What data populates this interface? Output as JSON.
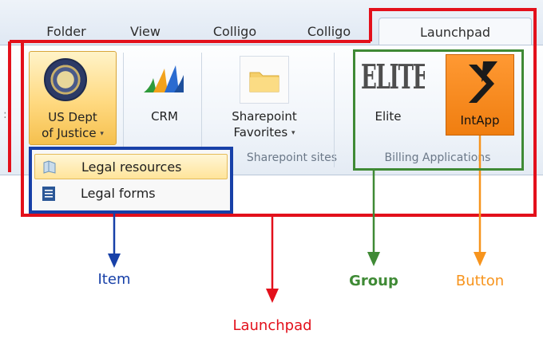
{
  "ribbon": {
    "tabs": [
      "Folder",
      "View",
      "Colligo",
      "Colligo"
    ],
    "active_tab": "Launchpad",
    "buttons": {
      "doj": {
        "line1": "US Dept",
        "line2": "of Justice",
        "caret": "▾",
        "icon": "seal-icon"
      },
      "crm": {
        "label": "CRM",
        "icon": "crm-icon"
      },
      "sharepoint": {
        "line1": "Sharepoint",
        "line2": "Favorites",
        "caret": "▾",
        "icon": "folder-icon"
      },
      "elite": {
        "label": "Elite",
        "logo_text": "ELITE"
      },
      "intapp": {
        "label": "IntApp",
        "icon": "intapp-icon"
      }
    },
    "groups": {
      "sharepoint": "Sharepoint sites",
      "billing": "Billing Applications"
    }
  },
  "dropdown": {
    "items": [
      {
        "label": "Legal resources",
        "icon": "book-icon",
        "highlighted": true
      },
      {
        "label": "Legal forms",
        "icon": "document-icon",
        "highlighted": false
      }
    ]
  },
  "annotations": {
    "item": "Item",
    "launchpad": "Launchpad",
    "group": "Group",
    "button": "Button"
  },
  "colors": {
    "launchpad": "#e3101b",
    "item": "#1740a8",
    "group": "#3f8a35",
    "button": "#f7941d",
    "intapp_orange": "#f7941d"
  }
}
